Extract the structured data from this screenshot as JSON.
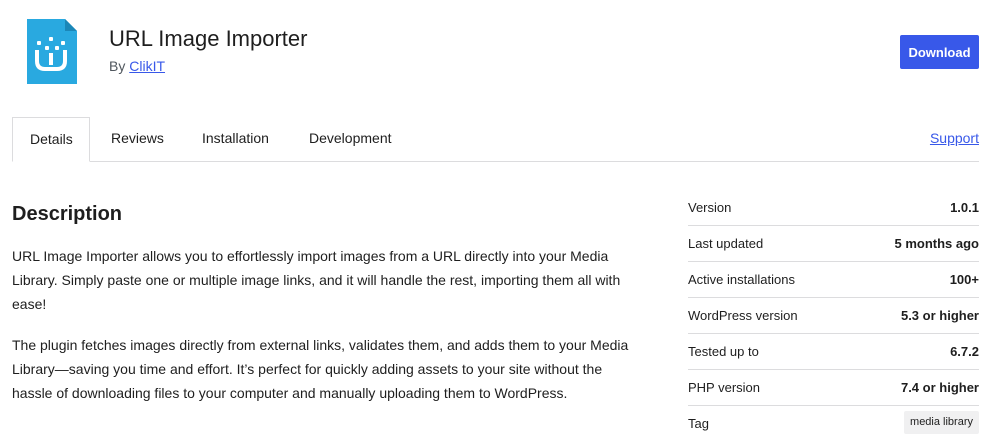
{
  "header": {
    "title": "URL Image Importer",
    "by_prefix": "By",
    "author": "ClikIT",
    "download_label": "Download",
    "icon_color": "#29a9e0"
  },
  "tabs": [
    {
      "label": "Details",
      "active": true
    },
    {
      "label": "Reviews",
      "active": false
    },
    {
      "label": "Installation",
      "active": false
    },
    {
      "label": "Development",
      "active": false
    }
  ],
  "support_label": "Support",
  "description": {
    "heading": "Description",
    "paragraphs": [
      "URL Image Importer allows you to effortlessly import images from a URL directly into your Media Library. Simply paste one or multiple image links, and it will handle the rest, importing them all with ease!",
      "The plugin fetches images directly from external links, validates them, and adds them to your Media Library—saving you time and effort. It’s perfect for quickly adding assets to your site without the hassle of downloading files to your computer and manually uploading them to WordPress."
    ]
  },
  "meta": [
    {
      "label": "Version",
      "value": "1.0.1"
    },
    {
      "label": "Last updated",
      "value": "5 months ago"
    },
    {
      "label": "Active installations",
      "value": "100+"
    },
    {
      "label": "WordPress version",
      "value": "5.3 or higher"
    },
    {
      "label": "Tested up to",
      "value": "6.7.2"
    },
    {
      "label": "PHP version",
      "value": "7.4 or higher"
    },
    {
      "label": "Tag",
      "value": "media library"
    }
  ],
  "colors": {
    "accent": "#3858e9",
    "border": "#dcdcde"
  }
}
